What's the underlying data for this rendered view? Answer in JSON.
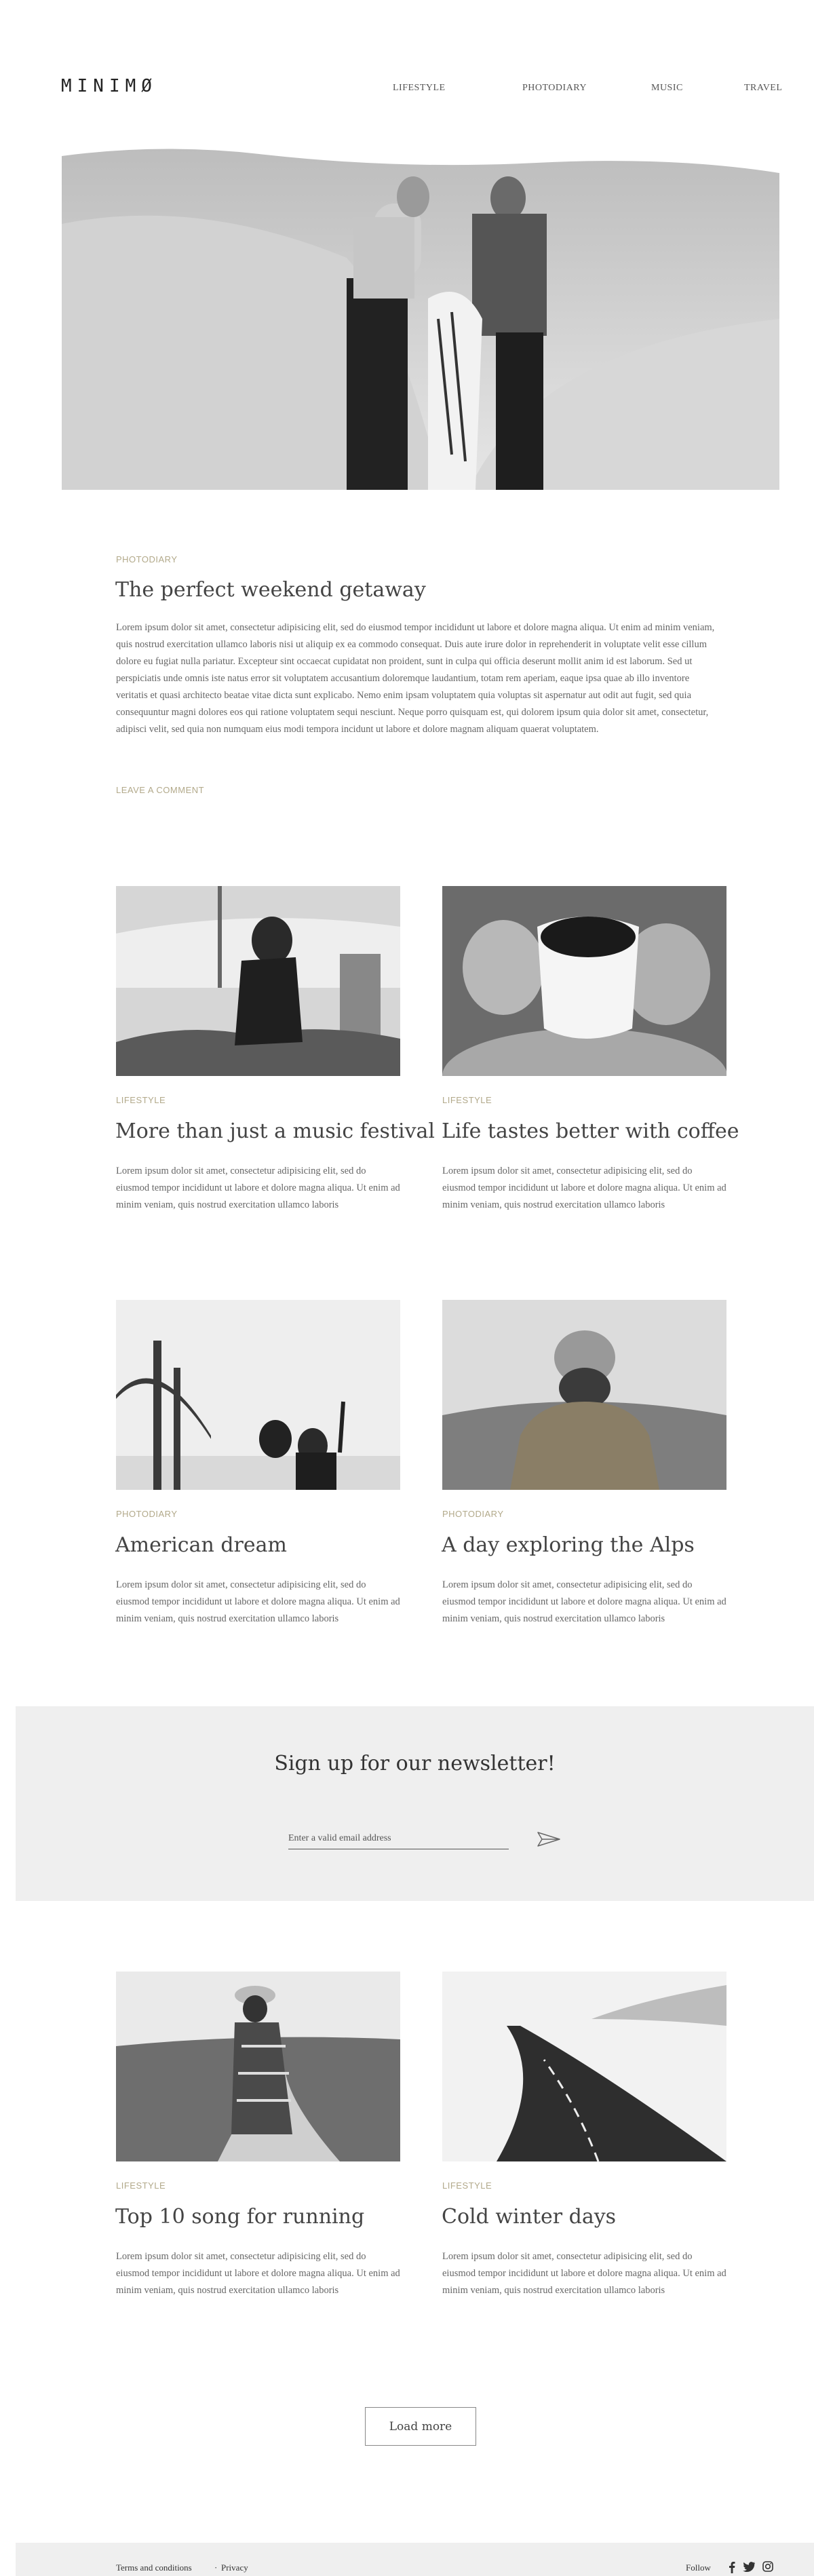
{
  "brand": {
    "logo": "MINIMØ"
  },
  "nav": {
    "items": [
      {
        "label": "LIFESTYLE"
      },
      {
        "label": "PHOTODIARY"
      },
      {
        "label": "MUSIC"
      },
      {
        "label": "TRAVEL"
      }
    ]
  },
  "featured": {
    "category": "PHOTODIARY",
    "title": "The perfect weekend getaway",
    "body": "Lorem ipsum dolor sit amet, consectetur adipisicing elit, sed do eiusmod tempor incididunt ut labore et dolore magna aliqua. Ut enim ad minim veniam, quis nostrud exercitation ullamco laboris nisi ut aliquip ex ea commodo consequat. Duis aute irure dolor in reprehenderit in voluptate velit esse cillum dolore eu fugiat nulla pariatur. Excepteur sint occaecat cupidatat non proident, sunt in culpa qui officia deserunt mollit anim id est laborum. Sed ut perspiciatis unde omnis iste natus error sit voluptatem accusantium doloremque laudantium, totam rem aperiam, eaque ipsa quae ab illo inventore veritatis et quasi architecto beatae vitae dicta sunt explicabo. Nemo enim ipsam voluptatem quia voluptas sit aspernatur aut odit aut fugit, sed quia consequuntur magni dolores eos qui ratione voluptatem sequi nesciunt. Neque porro quisquam est, qui dolorem ipsum quia dolor sit amet, consectetur, adipisci velit, sed quia non numquam eius modi tempora incidunt ut labore et dolore magnam aliquam quaerat voluptatem.",
    "cta": "LEAVE A COMMENT"
  },
  "posts": [
    {
      "category": "LIFESTYLE",
      "title": "More than just a music festival",
      "excerpt": "Lorem ipsum dolor sit amet, consectetur adipisicing elit, sed do eiusmod tempor incididunt ut labore et dolore magna aliqua. Ut enim ad minim veniam, quis nostrud exercitation ullamco laboris"
    },
    {
      "category": "LIFESTYLE",
      "title": "Life tastes better with coffee",
      "excerpt": "Lorem ipsum dolor sit amet, consectetur adipisicing elit, sed do eiusmod tempor incididunt ut labore et dolore magna aliqua. Ut enim ad minim veniam, quis nostrud exercitation ullamco laboris"
    },
    {
      "category": "PHOTODIARY",
      "title": "American dream",
      "excerpt": "Lorem ipsum dolor sit amet, consectetur adipisicing elit, sed do eiusmod tempor incididunt ut labore et dolore magna aliqua. Ut enim ad minim veniam, quis nostrud exercitation ullamco laboris"
    },
    {
      "category": "PHOTODIARY",
      "title": "A day exploring the Alps",
      "excerpt": "Lorem ipsum dolor sit amet, consectetur adipisicing elit, sed do eiusmod tempor incididunt ut labore et dolore magna aliqua. Ut enim ad minim veniam, quis nostrud exercitation ullamco laboris"
    },
    {
      "category": "LIFESTYLE",
      "title": "Top 10 song for running",
      "excerpt": "Lorem ipsum dolor sit amet, consectetur adipisicing elit, sed do eiusmod tempor incididunt ut labore et dolore magna aliqua. Ut enim ad minim veniam, quis nostrud exercitation ullamco laboris"
    },
    {
      "category": "LIFESTYLE",
      "title": "Cold winter days",
      "excerpt": "Lorem ipsum dolor sit amet, consectetur adipisicing elit, sed do eiusmod tempor incididunt ut labore et dolore magna aliqua. Ut enim ad minim veniam, quis nostrud exercitation ullamco laboris"
    }
  ],
  "newsletter": {
    "title": "Sign up for our newsletter!",
    "placeholder": "Enter a valid email address",
    "send_icon": "paper-plane-icon"
  },
  "load_more": {
    "label": "Load more"
  },
  "footer": {
    "links": [
      {
        "label": "Terms and conditions"
      },
      {
        "label": "Privacy"
      }
    ],
    "follow_label": "Follow",
    "social_icons": [
      "facebook-icon",
      "twitter-icon",
      "instagram-icon"
    ]
  }
}
